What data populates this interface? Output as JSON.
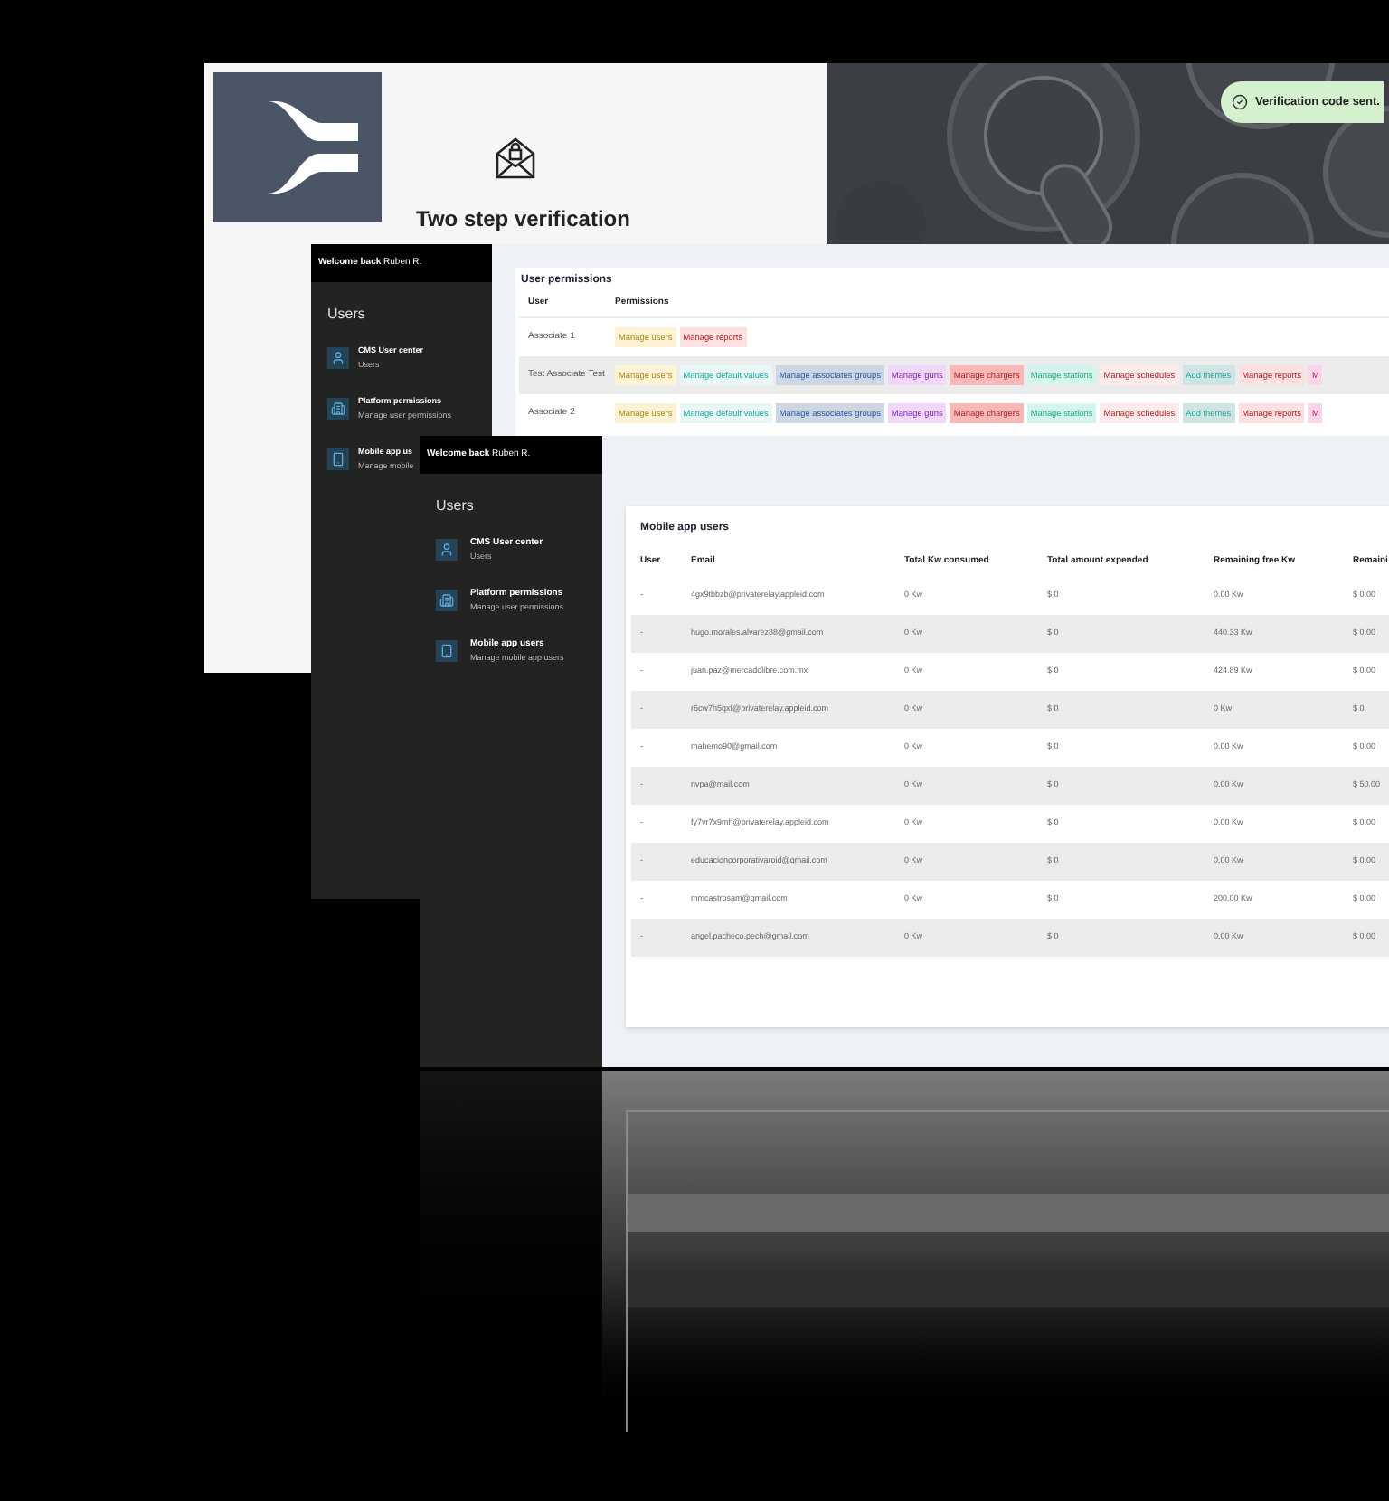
{
  "verification_screen": {
    "title": "Two step verification",
    "toast": "Verification code sent."
  },
  "permissions_screen": {
    "header": "**Welcome back** Ruben R.",
    "sidebar_title": "Users",
    "nav": [
      {
        "kind": "person",
        "title": "CMS User center",
        "subtitle": "Users"
      },
      {
        "kind": "building",
        "title": "Platform permissions",
        "subtitle": "Manage user permissions"
      },
      {
        "kind": "phone",
        "title": "Mobile app us",
        "subtitle": "Manage mobile"
      }
    ],
    "card_title": "User permissions",
    "columns": [
      "User",
      "Permissions"
    ],
    "rows": [
      {
        "user": "Associate 1",
        "permissions": [
          {
            "label": "Manage users",
            "color": "#fdf3d3"
          },
          {
            "label": "Manage reports",
            "color": "#fde0e0"
          }
        ]
      },
      {
        "user": "Test Associate Test",
        "permissions": [
          {
            "label": "Manage users",
            "color": "#fdf3d3"
          },
          {
            "label": "Manage default values",
            "color": "#e8f6f6"
          },
          {
            "label": "Manage associates groups",
            "color": "#cdd6e3"
          },
          {
            "label": "Manage guns",
            "color": "#f1d8fb"
          },
          {
            "label": "Manage chargers",
            "color": "#f9b8b8"
          },
          {
            "label": "Manage stations",
            "color": "#d3f5ec"
          },
          {
            "label": "Manage schedules",
            "color": "#fdeaea"
          },
          {
            "label": "Add themes",
            "color": "#cfe5e3"
          },
          {
            "label": "Manage reports",
            "color": "#fde0e0"
          },
          {
            "label": "M",
            "color": "#fbd5e8"
          }
        ]
      },
      {
        "user": "Associate 2",
        "permissions": [
          {
            "label": "Manage users",
            "color": "#fdf3d3"
          },
          {
            "label": "Manage default values",
            "color": "#e8f6f6"
          },
          {
            "label": "Manage associates groups",
            "color": "#cdd6e3"
          },
          {
            "label": "Manage guns",
            "color": "#f1d8fb"
          },
          {
            "label": "Manage chargers",
            "color": "#f9b8b8"
          },
          {
            "label": "Manage stations",
            "color": "#d3f5ec"
          },
          {
            "label": "Manage schedules",
            "color": "#fdeaea"
          },
          {
            "label": "Add themes",
            "color": "#cfe5e3"
          },
          {
            "label": "Manage reports",
            "color": "#fde0e0"
          },
          {
            "label": "M",
            "color": "#fbd5e8"
          }
        ]
      }
    ]
  },
  "mobile_users_screen": {
    "header": "**Welcome back** Ruben R.",
    "sidebar_title": "Users",
    "nav": [
      {
        "kind": "person",
        "title": "CMS User center",
        "subtitle": "Users"
      },
      {
        "kind": "building",
        "title": "Platform permissions",
        "subtitle": "Manage user permissions"
      },
      {
        "kind": "phone",
        "title": "Mobile app users",
        "subtitle": "Manage mobile app users"
      }
    ],
    "card_title": "Mobile app users",
    "columns": [
      "User",
      "Email",
      "Total Kw consumed",
      "Total amount expended",
      "Remaining free Kw",
      "Remaini"
    ],
    "rows": [
      [
        "-",
        "4gx9tbbzb@privaterelay.appleid.com",
        "0 Kw",
        "$ 0",
        "0.00 Kw",
        "$ 0.00"
      ],
      [
        "-",
        "hugo.morales.alvarez88@gmail.com",
        "0 Kw",
        "$ 0",
        "440.33 Kw",
        "$ 0.00"
      ],
      [
        "-",
        "juan.paz@mercadolibre.com.mx",
        "0 Kw",
        "$ 0",
        "424.89 Kw",
        "$ 0.00"
      ],
      [
        "-",
        "r6cw7h5qxf@privaterelay.appleid.com",
        "0 Kw",
        "$ 0",
        "0 Kw",
        "$ 0"
      ],
      [
        "-",
        "mahemo90@gmail.com",
        "0 Kw",
        "$ 0",
        "0.00 Kw",
        "$ 0.00"
      ],
      [
        "-",
        "nvpa@mail.com",
        "0 Kw",
        "$ 0",
        "0.00 Kw",
        "$ 50.00"
      ],
      [
        "-",
        "fy7vr7x9mh@privaterelay.appleid.com",
        "0 Kw",
        "$ 0",
        "0.00 Kw",
        "$ 0.00"
      ],
      [
        "-",
        "educacioncorporativaroid@gmail.com",
        "0 Kw",
        "$ 0",
        "0.00 Kw",
        "$ 0.00"
      ],
      [
        "-",
        "mmcastrosam@gmail.com",
        "0 Kw",
        "$ 0",
        "200.00 Kw",
        "$ 0.00"
      ],
      [
        "-",
        "angel.pacheco.pech@gmail.com",
        "0 Kw",
        "$ 0",
        "0.00 Kw",
        "$ 0.00"
      ]
    ]
  }
}
